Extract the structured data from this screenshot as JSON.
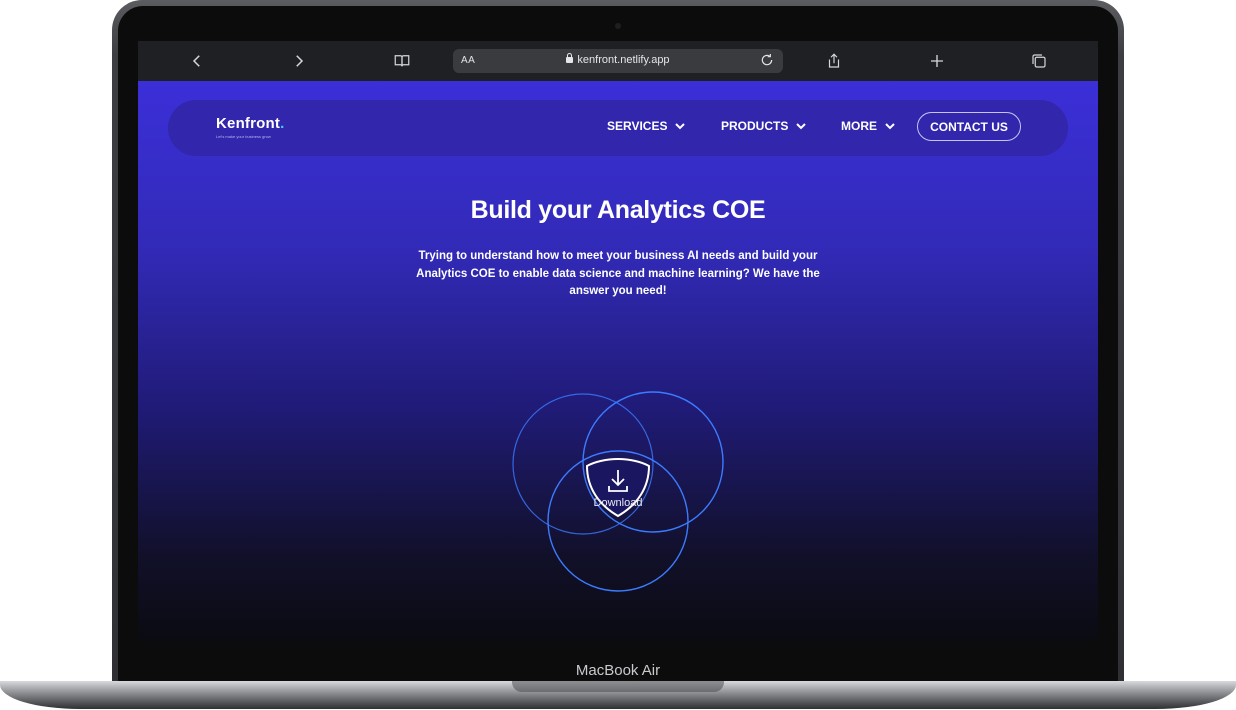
{
  "browser": {
    "text_size_button": "AA",
    "url": "kenfront.netlify.app",
    "icons": [
      "back-icon",
      "forward-icon",
      "bookmarks-icon",
      "lock-icon",
      "reload-icon",
      "share-icon",
      "new-tab-icon",
      "tabs-icon"
    ]
  },
  "site": {
    "logo": "Kenfront",
    "logo_dot": ".",
    "tagline": "Let's make your business grow",
    "nav": {
      "services": "SERVICES",
      "products": "PRODUCTS",
      "more": "MORE",
      "contact": "CONTACT US"
    },
    "hero": {
      "title": "Build your Analytics COE",
      "lead": "Trying to understand how to meet your business AI needs and build your Analytics COE to enable data science and machine learning? We have the answer you need!",
      "download_label": "Download"
    }
  },
  "device_label": "MacBook Air",
  "colors": {
    "accent": "#3fd0ff",
    "nav_bg": "#3026aa",
    "hero_top": "#3b2fd8",
    "ring": "#3b7cff"
  }
}
